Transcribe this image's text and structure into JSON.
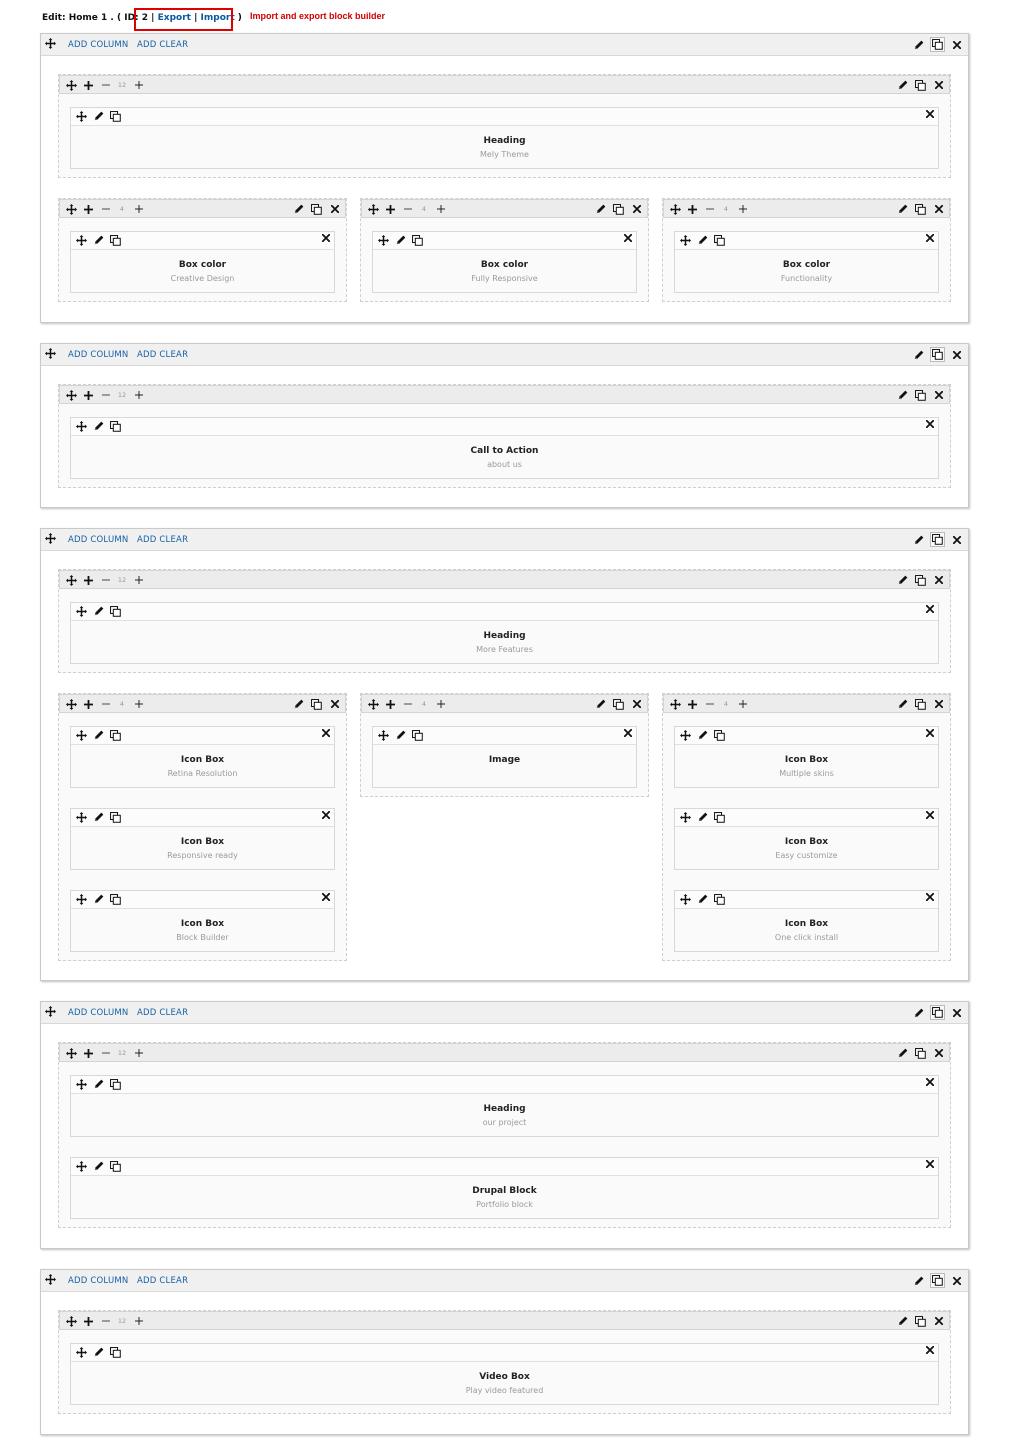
{
  "header": {
    "prefix": "Edit: Home 1 . ( ID: 2 |",
    "export_label": "Export",
    "separator": "|",
    "import_label": "Import",
    "suffix": ")",
    "annotation": "Import and export block builder"
  },
  "labels": {
    "add_column": "ADD COLUMN",
    "add_clear": "ADD CLEAR",
    "size_12": "12",
    "size_4": "4"
  },
  "colors": {
    "annotation": "#e00000",
    "link": "#1560a6"
  },
  "sections": [
    {
      "columns": [
        {
          "size": "12",
          "blocks": [
            {
              "title": "Heading",
              "subtitle": "Mely Theme"
            }
          ]
        },
        {
          "size": "4",
          "blocks": [
            {
              "title": "Box color",
              "subtitle": "Creative Design"
            }
          ]
        },
        {
          "size": "4",
          "blocks": [
            {
              "title": "Box color",
              "subtitle": "Fully Responsive"
            }
          ]
        },
        {
          "size": "4",
          "blocks": [
            {
              "title": "Box color",
              "subtitle": "Functionality"
            }
          ]
        }
      ]
    },
    {
      "columns": [
        {
          "size": "12",
          "blocks": [
            {
              "title": "Call to Action",
              "subtitle": "about us"
            }
          ]
        }
      ]
    },
    {
      "columns": [
        {
          "size": "12",
          "blocks": [
            {
              "title": "Heading",
              "subtitle": "More Features"
            }
          ]
        },
        {
          "size": "4",
          "blocks": [
            {
              "title": "Icon Box",
              "subtitle": "Retina Resolution"
            },
            {
              "title": "Icon Box",
              "subtitle": "Responsive ready"
            },
            {
              "title": "Icon Box",
              "subtitle": "Block Builder"
            }
          ]
        },
        {
          "size": "4",
          "blocks": [
            {
              "title": "Image",
              "subtitle": ""
            }
          ]
        },
        {
          "size": "4",
          "blocks": [
            {
              "title": "Icon Box",
              "subtitle": "Multiple skins"
            },
            {
              "title": "Icon Box",
              "subtitle": "Easy customize"
            },
            {
              "title": "Icon Box",
              "subtitle": "One click install"
            }
          ]
        }
      ]
    },
    {
      "columns": [
        {
          "size": "12",
          "blocks": [
            {
              "title": "Heading",
              "subtitle": "our project"
            },
            {
              "title": "Drupal Block",
              "subtitle": "Portfolio block"
            }
          ]
        }
      ]
    },
    {
      "columns": [
        {
          "size": "12",
          "blocks": [
            {
              "title": "Video Box",
              "subtitle": "Play video featured"
            }
          ]
        }
      ]
    }
  ]
}
